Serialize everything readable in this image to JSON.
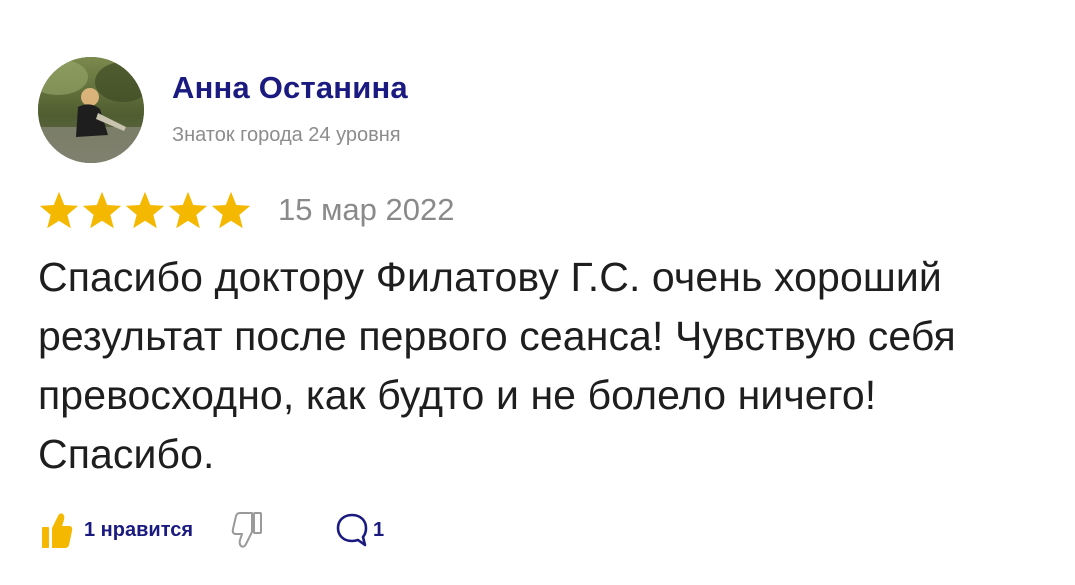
{
  "author": {
    "name": "Анна Останина",
    "level": "Знаток города 24 уровня",
    "avatar_icon": "user-photo-avatar"
  },
  "review": {
    "rating": 5,
    "rating_max": 5,
    "date": "15 мар 2022",
    "text": "Спасибо доктору Филатову Г.С. очень хороший результат после первого сеанса! Чувствую себя превосходно, как будто и не болело ничего! Спасибо."
  },
  "actions": {
    "like_label": "1 нравится",
    "like_icon": "thumbs-up-icon",
    "dislike_icon": "thumbs-down-icon",
    "comment_icon": "comment-icon",
    "comment_count": "1"
  },
  "colors": {
    "name": "#1a1a80",
    "star": "#f5b800",
    "like_icon": "#f5b800",
    "muted_text": "#8c8c8c"
  }
}
